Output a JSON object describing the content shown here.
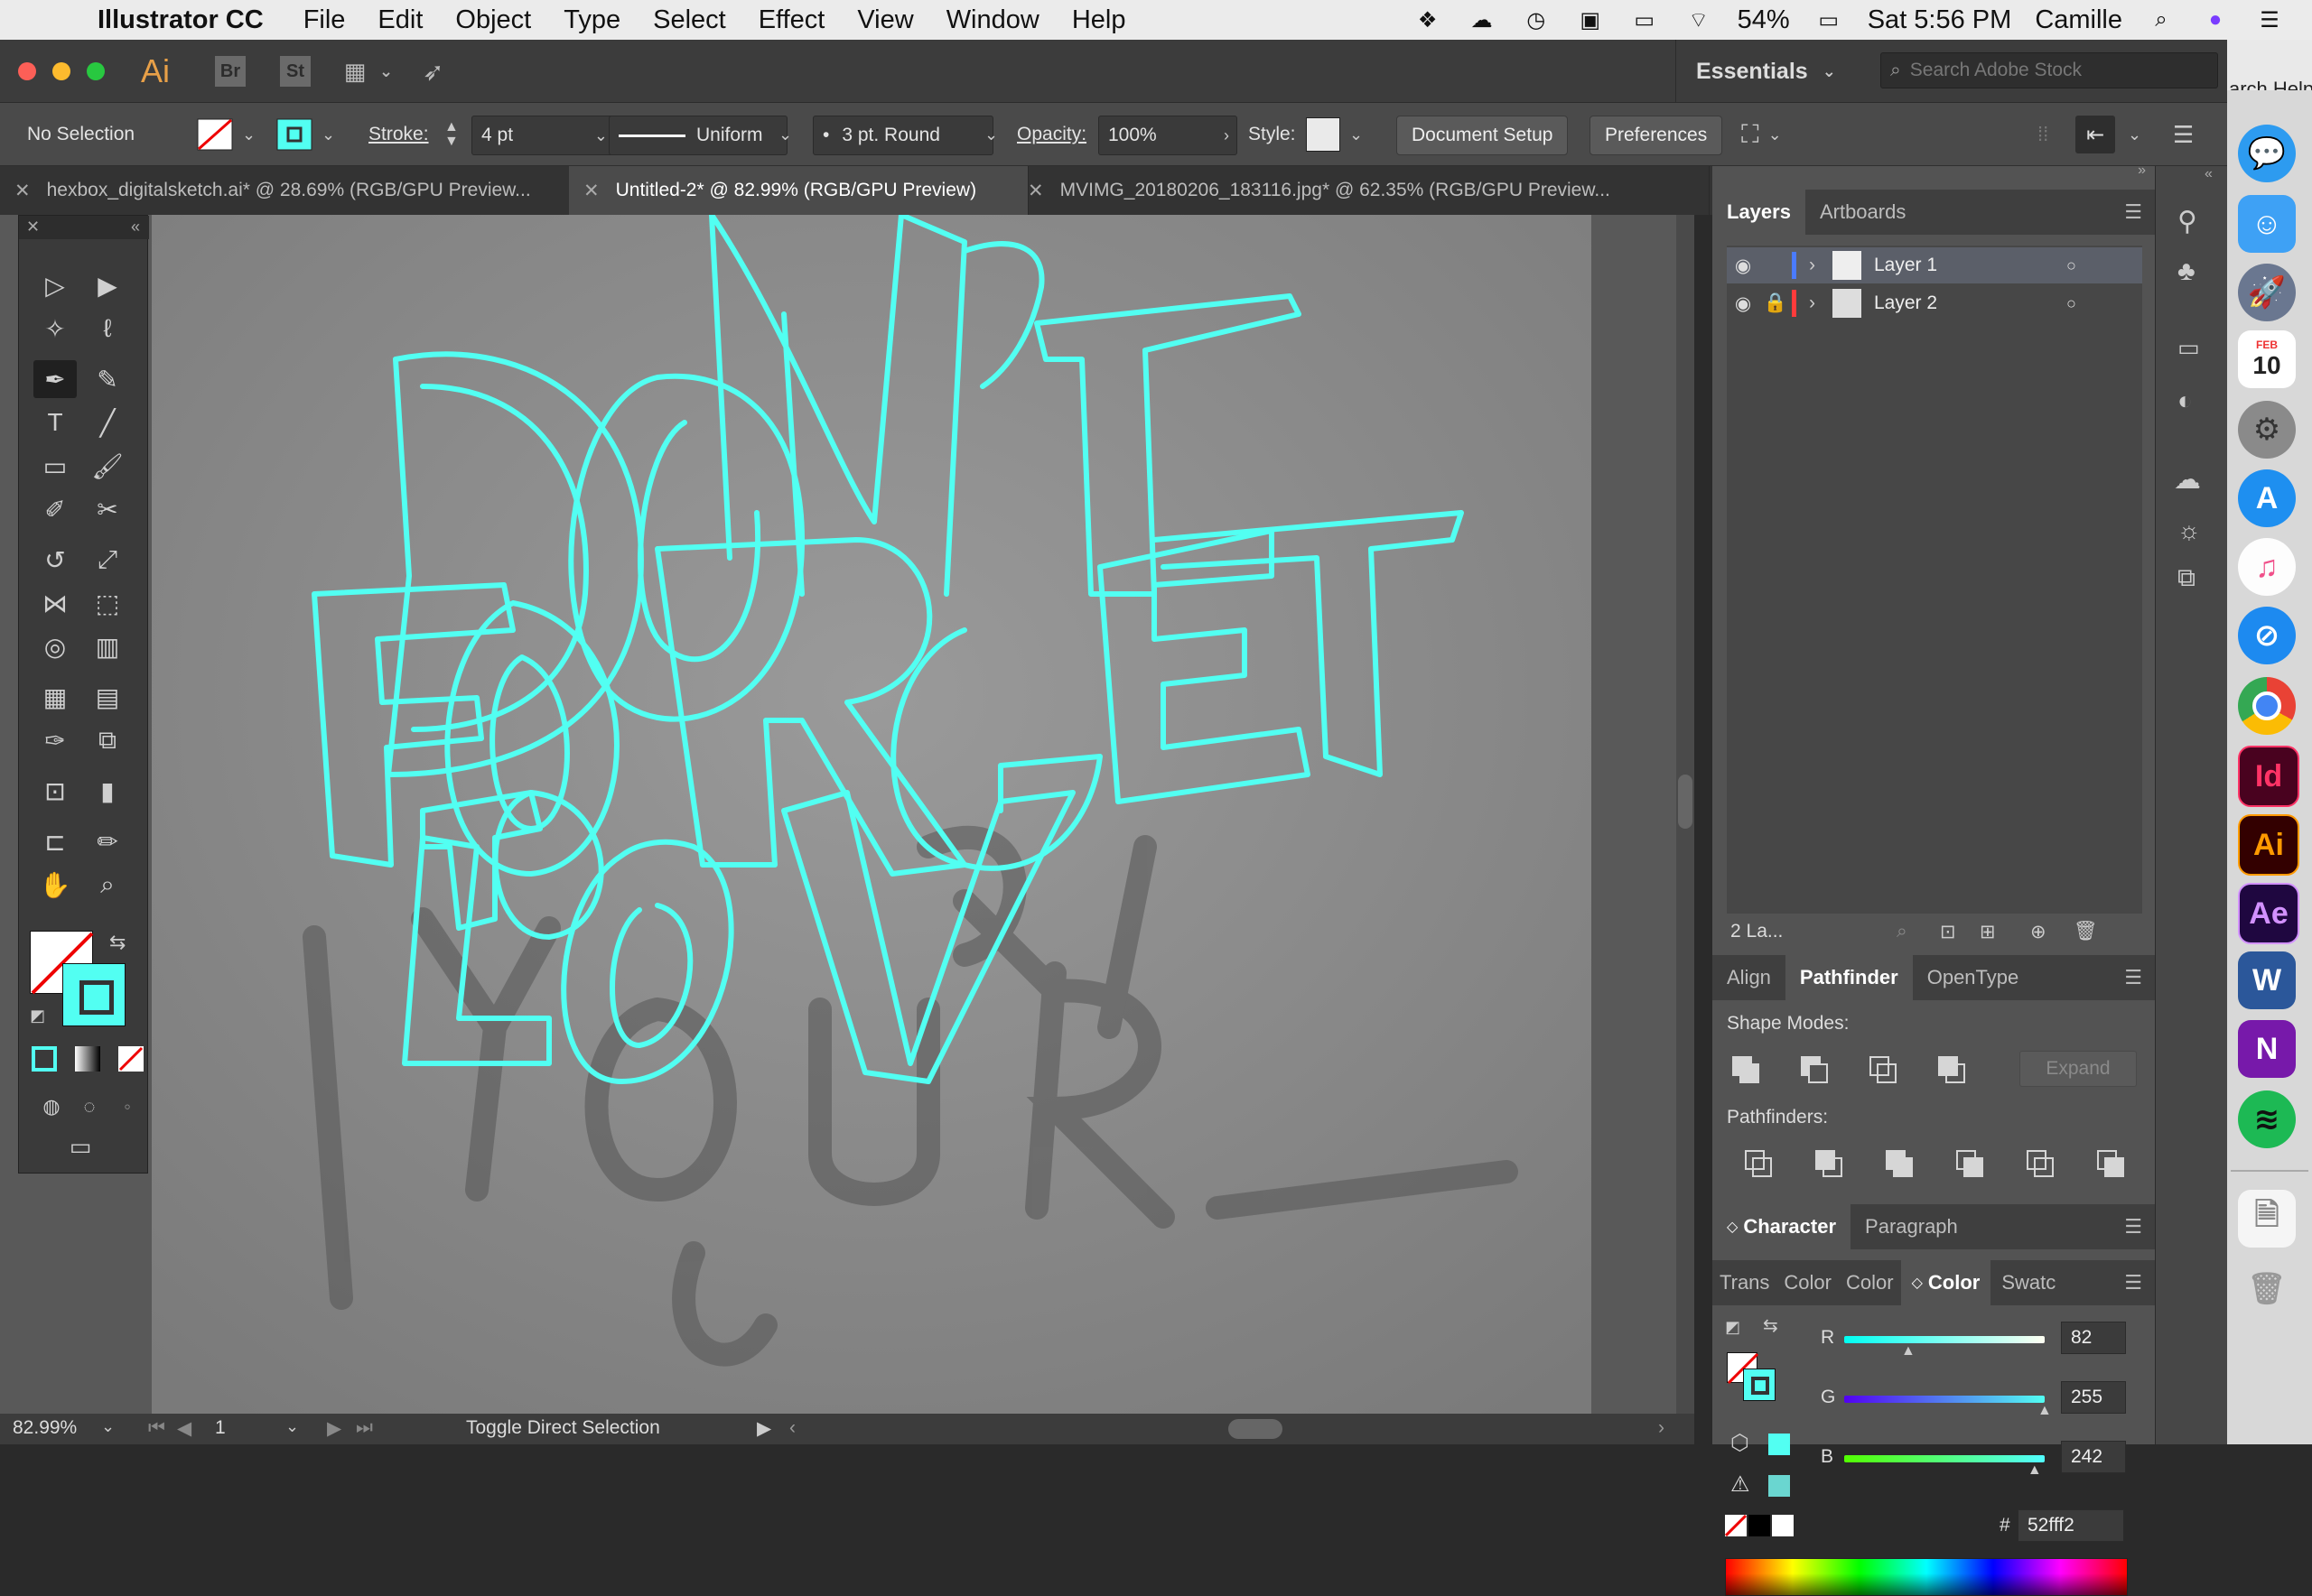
{
  "menubar": {
    "app_name": "Illustrator CC",
    "items": [
      "File",
      "Edit",
      "Object",
      "Type",
      "Select",
      "Effect",
      "View",
      "Window",
      "Help"
    ],
    "battery": "54%",
    "clock": "Sat 5:56 PM",
    "user": "Camille"
  },
  "apphead": {
    "logo": "Ai",
    "bridge": "Br",
    "stock": "St",
    "workspace": "Essentials",
    "search_placeholder": "Search Adobe Stock",
    "search_help_partial": "arch Help"
  },
  "control": {
    "selection": "No Selection",
    "stroke_label": "Stroke:",
    "stroke_value": "4 pt",
    "profile": "Uniform",
    "brush": "3 pt. Round",
    "opacity_label": "Opacity:",
    "opacity_value": "100%",
    "style_label": "Style:",
    "doc_setup": "Document Setup",
    "preferences": "Preferences"
  },
  "tabs": [
    {
      "label": "hexbox_digitalsketch.ai* @ 28.69% (RGB/GPU Preview..."
    },
    {
      "label": "Untitled-2* @ 82.99% (RGB/GPU Preview)"
    },
    {
      "label": "MVIMG_20180206_183116.jpg* @ 62.35% (RGB/GPU Preview..."
    }
  ],
  "status": {
    "zoom": "82.99%",
    "artboard": "1",
    "hint": "Toggle Direct Selection"
  },
  "layers_panel": {
    "tabs": [
      "Layers",
      "Artboards"
    ],
    "layers": [
      {
        "name": "Layer 1",
        "color": "#4a7bff"
      },
      {
        "name": "Layer 2",
        "color": "#ff3b3b"
      }
    ],
    "count": "2 La..."
  },
  "pathfinder_panel": {
    "tabs": [
      "Align",
      "Pathfinder",
      "OpenType"
    ],
    "shape_modes": "Shape Modes:",
    "expand": "Expand",
    "pathfinders": "Pathfinders:"
  },
  "character_panel": {
    "tabs": [
      "Character",
      "Paragraph"
    ]
  },
  "color_panel": {
    "tabs": [
      "Trans",
      "Color",
      "Color",
      "Color",
      "Swatc"
    ],
    "r_label": "R",
    "g_label": "G",
    "b_label": "B",
    "r": "82",
    "g": "255",
    "b": "242",
    "r_pct": 32,
    "g_pct": 100,
    "b_pct": 95,
    "hash": "#",
    "hex": "52fff2",
    "stroke_color": "#52fff2"
  },
  "dock": {
    "calendar_month": "FEB",
    "calendar_day": "10",
    "id": "Id",
    "ai": "Ai",
    "ae": "Ae",
    "word": "W",
    "onenote": "N"
  }
}
